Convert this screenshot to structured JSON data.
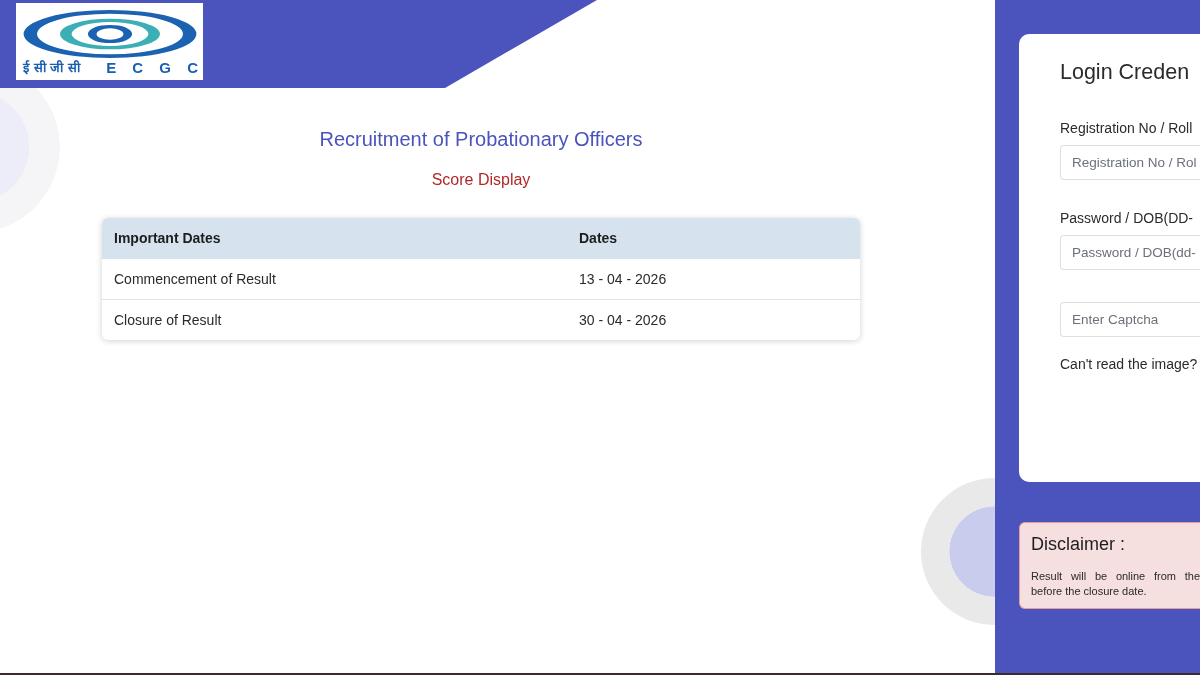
{
  "header": {
    "logo": {
      "hindi_text": "ई सी जी सी",
      "text": "E C G C"
    }
  },
  "main": {
    "title": "Recruitment of Probationary Officers",
    "subtitle": "Score Display"
  },
  "dates_table": {
    "columns": [
      "Important Dates",
      "Dates"
    ],
    "rows": [
      [
        "Commencement of Result",
        "13 - 04 - 2026"
      ],
      [
        "Closure of Result",
        "30 - 04 - 2026"
      ]
    ]
  },
  "login_card": {
    "title": "Login Creden",
    "fields": [
      {
        "label": "Registration No / Roll",
        "placeholder": "Registration No / Rol"
      },
      {
        "label": "Password / DOB(DD-",
        "placeholder": "Password / DOB(dd-"
      },
      {
        "placeholder": "Enter Captcha"
      }
    ],
    "help_text": "Can't read the image?"
  },
  "disclaimer": {
    "title": "Disclaimer :",
    "text_lines": [
      "Result will be online from the",
      "before the closure date."
    ]
  }
}
